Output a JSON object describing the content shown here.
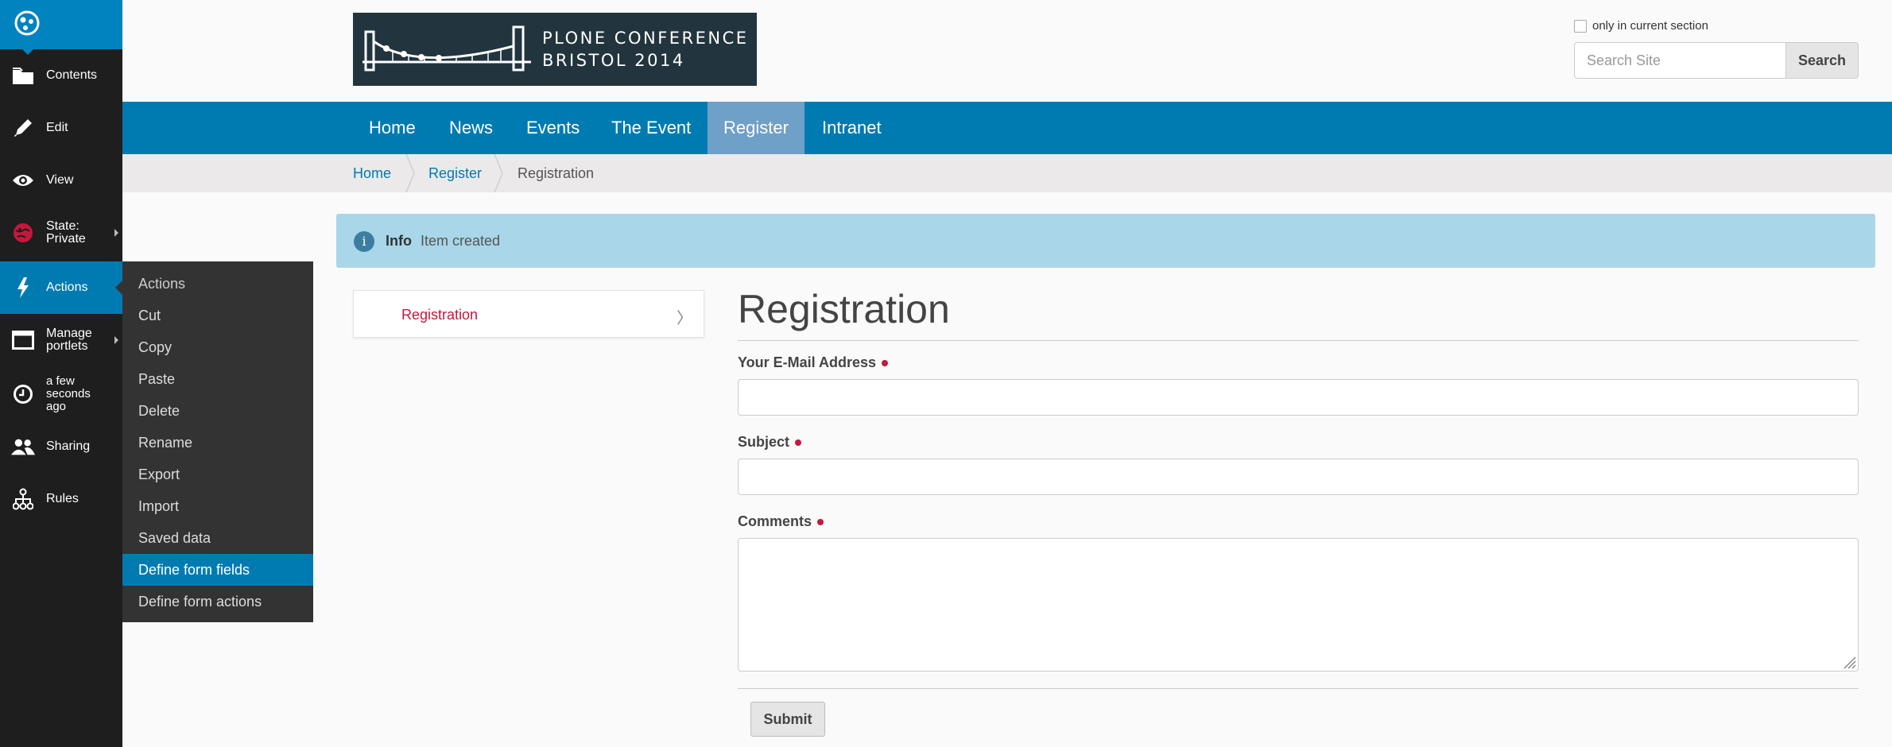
{
  "toolbar": {
    "items": [
      {
        "label": "Contents",
        "icon": "folder-icon"
      },
      {
        "label": "Edit",
        "icon": "pencil-icon"
      },
      {
        "label": "View",
        "icon": "eye-icon"
      },
      {
        "label_line1": "State:",
        "label_line2": "Private",
        "icon": "state-icon"
      },
      {
        "label": "Actions",
        "icon": "lightning-icon"
      },
      {
        "label_line1": "Manage",
        "label_line2": "portlets",
        "icon": "portlet-icon"
      },
      {
        "label_line1": "a few",
        "label_line2": "seconds",
        "label_line3": "ago",
        "icon": "clock-icon"
      },
      {
        "label": "Sharing",
        "icon": "users-icon"
      },
      {
        "label": "Rules",
        "icon": "rules-icon"
      }
    ]
  },
  "actions_menu": {
    "header": "Actions",
    "items": [
      "Cut",
      "Copy",
      "Paste",
      "Delete",
      "Rename",
      "Export",
      "Import",
      "Saved data",
      "Define form fields",
      "Define form actions"
    ],
    "selected": "Define form fields"
  },
  "header": {
    "logo_line1": "PLONE CONFERENCE",
    "logo_line2": "BRISTOL 2014",
    "only_current_section": "only in current section",
    "search_placeholder": "Search Site",
    "search_button": "Search"
  },
  "globalnav": {
    "items": [
      "Home",
      "News",
      "Events",
      "The Event",
      "Register",
      "Intranet"
    ],
    "selected": "Register"
  },
  "breadcrumbs": {
    "items": [
      "Home",
      "Register",
      "Registration"
    ]
  },
  "status_message": {
    "label": "Info",
    "text": "Item created"
  },
  "portlet": {
    "link": "Registration"
  },
  "form": {
    "title": "Registration",
    "fields": {
      "email_label": "Your E-Mail Address",
      "subject_label": "Subject",
      "comments_label": "Comments"
    },
    "submit": "Submit"
  },
  "colors": {
    "accent": "#007bb1",
    "toolbar_bg": "#1e1e1e",
    "required": "#c4183c",
    "info_bg": "#a9d6e9"
  }
}
